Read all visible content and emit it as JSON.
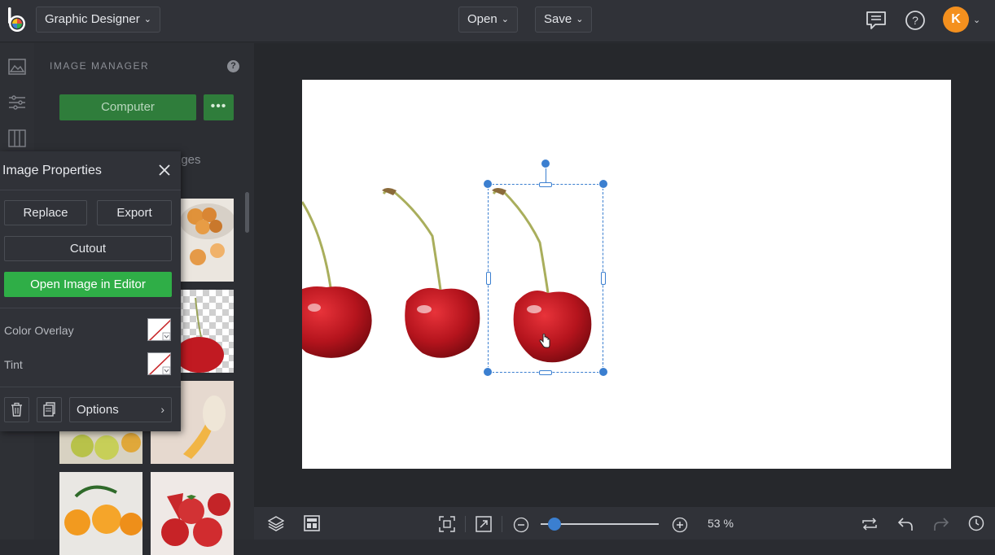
{
  "header": {
    "app_menu_label": "Graphic Designer",
    "open_label": "Open",
    "save_label": "Save",
    "user_initial": "K"
  },
  "colors": {
    "accent_green": "#2fae47",
    "muted_green": "#2f7d3b",
    "selection_blue": "#3b7fd0",
    "avatar_orange": "#f4901e"
  },
  "rail": {
    "items": [
      "image-icon",
      "adjustments-icon",
      "layout-icon"
    ]
  },
  "image_manager": {
    "title": "IMAGE MANAGER",
    "help": "?",
    "computer_button": "Computer",
    "more_button": "•••",
    "tab_label": "ages"
  },
  "image_properties": {
    "title": "Image Properties",
    "replace_label": "Replace",
    "export_label": "Export",
    "cutout_label": "Cutout",
    "open_editor_label": "Open Image in Editor",
    "color_overlay_label": "Color Overlay",
    "tint_label": "Tint",
    "options_label": "Options"
  },
  "zoom": {
    "level_text": "53 %",
    "value": 0.1
  }
}
